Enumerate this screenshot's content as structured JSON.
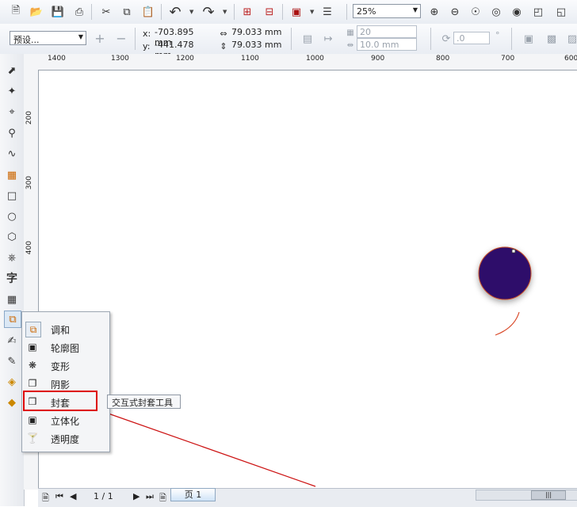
{
  "standard_toolbar": {
    "icons": [
      "new-icon",
      "open-icon",
      "save-icon",
      "print-icon",
      "cut-icon",
      "copy-icon",
      "paste-icon",
      "undo-icon",
      "redo-icon",
      "import-icon",
      "export-icon",
      "launcher-icon",
      "options-icon",
      "zoom-in-icon",
      "zoom-out-icon",
      "zoom-selected-icon",
      "zoom-all-icon",
      "zoom-page-icon",
      "zoom-width-icon"
    ],
    "zoom_value": "25%"
  },
  "property_bar": {
    "preset_value": "预设...",
    "x_label": "x:",
    "x_value": "-703.895 mm",
    "y_label": "y:",
    "y_value": "-441.478 mm",
    "width_value": "79.033 mm",
    "height_value": "79.033 mm",
    "steps_value": "20",
    "spacing_value": "10.0 mm",
    "angle_value": ".0",
    "angle_unit": "°"
  },
  "rulers": {
    "h_labels": [
      "1400",
      "1300",
      "1200",
      "1100",
      "1000",
      "900",
      "800",
      "700",
      "600"
    ],
    "v_labels": [
      "200",
      "300",
      "400"
    ]
  },
  "toolbox": {
    "tools": [
      "pick-tool-icon",
      "shape-tool-icon",
      "crop-tool-icon",
      "zoom-tool-icon",
      "freehand-tool-icon",
      "smart-fill-icon",
      "rectangle-tool-icon",
      "ellipse-tool-icon",
      "polygon-tool-icon",
      "basic-shapes-icon",
      "text-tool-icon",
      "table-tool-icon",
      "blend-tool-icon",
      "eyedropper-icon",
      "outline-tool-icon",
      "fill-tool-icon",
      "interactive-fill-icon"
    ],
    "text_glyph": "字"
  },
  "flyout": {
    "items": [
      {
        "label": "调和",
        "icon": "blend-icon"
      },
      {
        "label": "轮廓图",
        "icon": "contour-icon"
      },
      {
        "label": "变形",
        "icon": "distort-icon"
      },
      {
        "label": "阴影",
        "icon": "shadow-icon"
      },
      {
        "label": "封套",
        "icon": "envelope-icon"
      },
      {
        "label": "立体化",
        "icon": "extrude-icon"
      },
      {
        "label": "透明度",
        "icon": "transparency-icon"
      }
    ],
    "tooltip": "交互式封套工具"
  },
  "canvas": {
    "circle_fill": "#2e0f6b",
    "circle_outline": "#c8502a",
    "arc_color": "#d94a2a",
    "arrow_color": "#cc1111"
  },
  "status_bar": {
    "page_count": "1 / 1",
    "page_tab": "页 1"
  },
  "colors": {
    "highlight_box": "#dd0000"
  }
}
